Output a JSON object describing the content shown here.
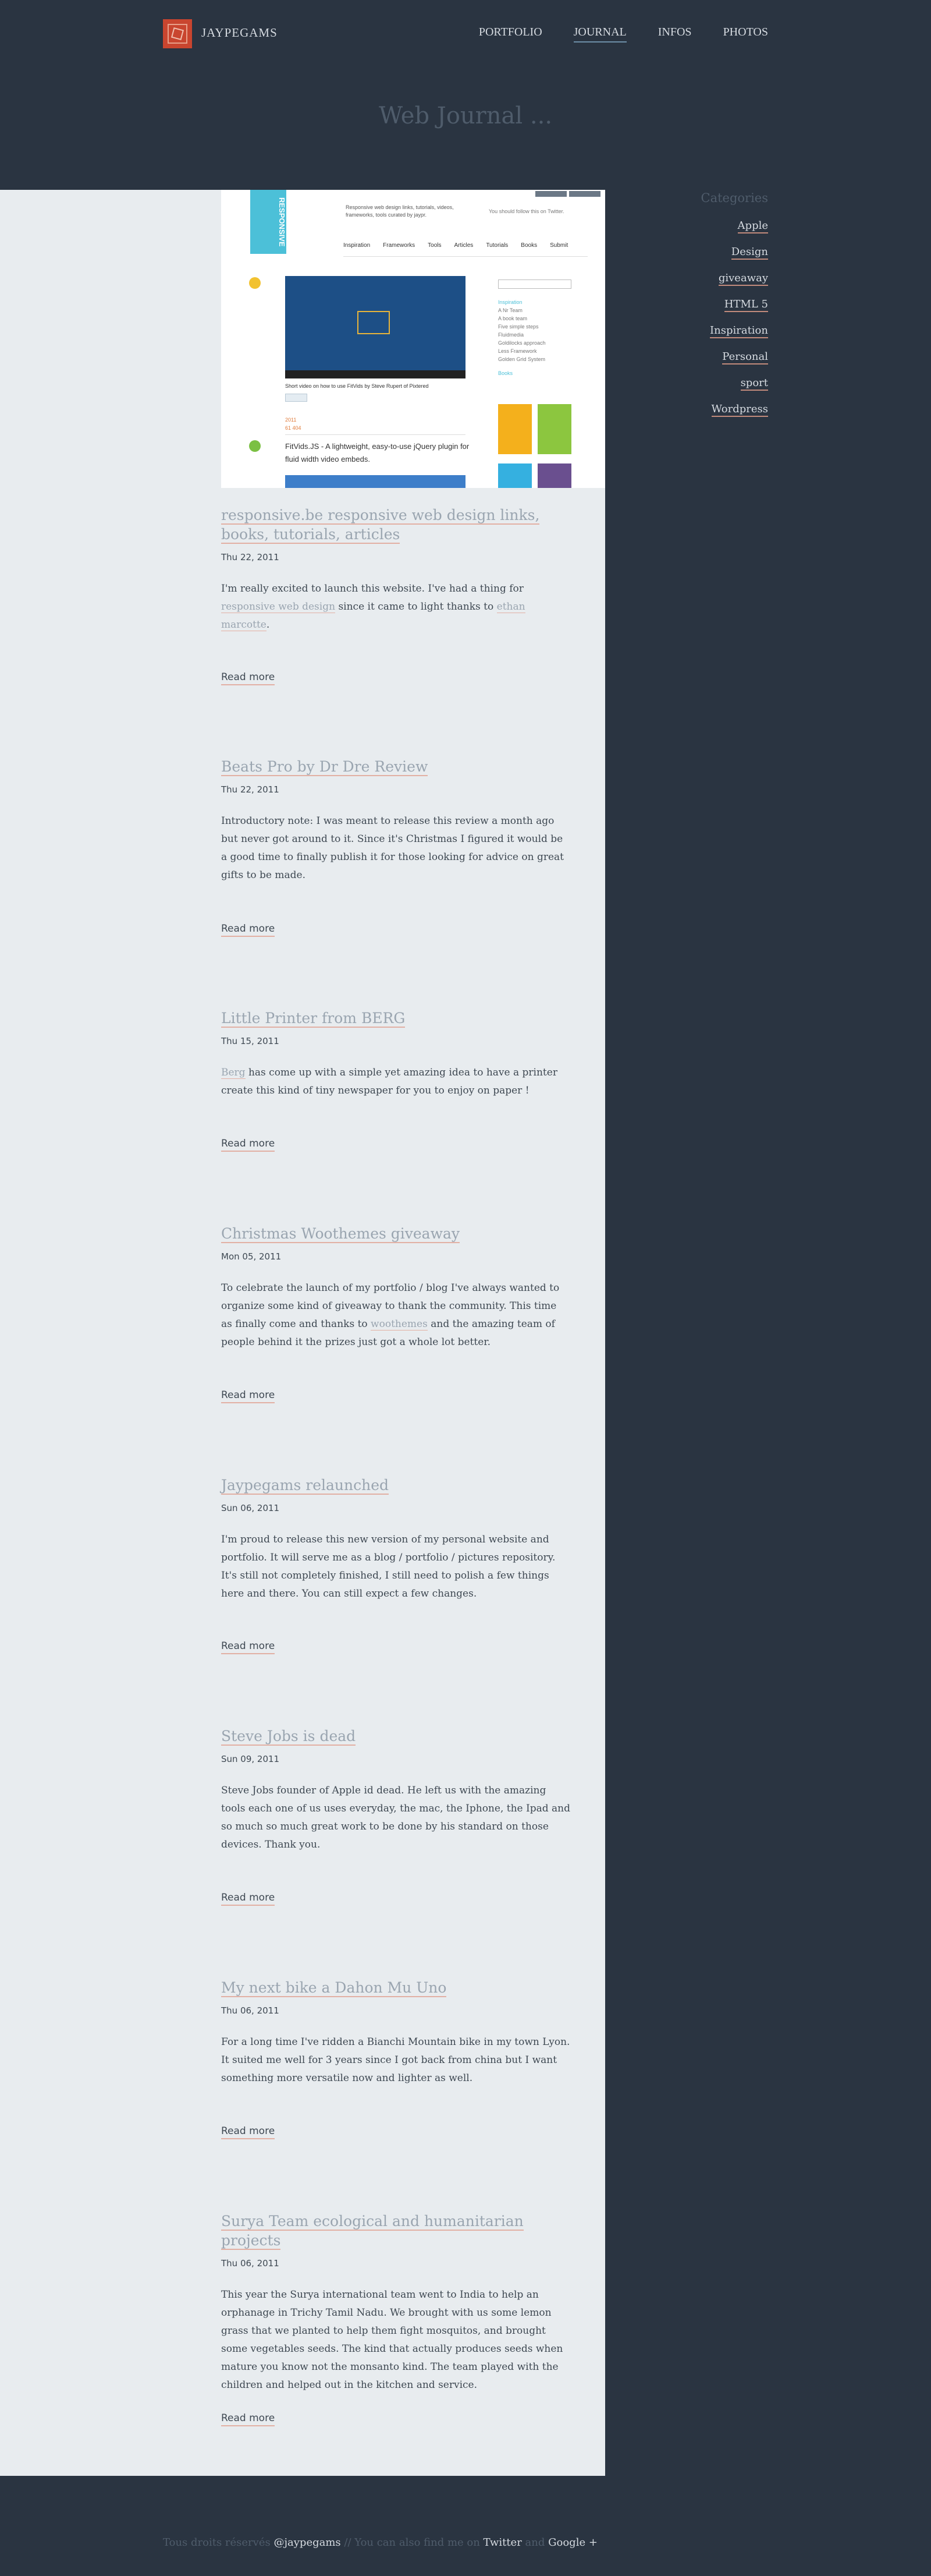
{
  "site": {
    "logo_text": "JAYPEGAMS",
    "nav": [
      {
        "label": "PORTFOLIO",
        "active": false
      },
      {
        "label": "JOURNAL",
        "active": true
      },
      {
        "label": "INFOS",
        "active": false
      },
      {
        "label": "PHOTOS",
        "active": false
      }
    ],
    "page_title": "Web Journal ..."
  },
  "hero": {
    "badge": "RESPONSIVE",
    "tagline": "Responsive web design links, tutorials, videos, frameworks, tools curated by jaypr.",
    "follow": "You should follow this on Twitter.",
    "menu": [
      "Inspiration",
      "Frameworks",
      "Tools",
      "Articles",
      "Tutorials",
      "Books",
      "Submit"
    ],
    "video_caption": "Short video on how to use FitVids by Steve Rupert of Pixtered",
    "tweet_label": "Tweet",
    "meta": [
      "2011",
      "61 404",
      "Video Tools"
    ],
    "fitvids_text": "FitVids.JS - A lightweight, easy-to-use jQuery plugin for fluid width video embeds.",
    "side_list": [
      "Inspiration",
      "A Nr Team",
      "A book team",
      "Five simple steps",
      "Fluidmedia",
      "Goldilocks approach",
      "Less Framework",
      "Golden Grid System",
      "Books"
    ]
  },
  "posts": [
    {
      "title": "responsive.be responsive web design links, books, tutorials, articles",
      "date": "Thu 22, 2011",
      "excerpt": [
        {
          "text": "I'm really excited to launch this website. I've had a thing for ",
          "link": false
        },
        {
          "text": "responsive web design",
          "link": true
        },
        {
          "text": " since it came to light thanks to ",
          "link": false
        },
        {
          "text": "ethan marcotte",
          "link": true
        },
        {
          "text": ".",
          "link": false
        }
      ],
      "read_more": "Read more"
    },
    {
      "title": "Beats Pro by Dr Dre Review",
      "date": "Thu 22, 2011",
      "excerpt": [
        {
          "text": "Introductory note: I was meant to release this review a month ago but never got around to it. Since it's Christmas I figured it would be a good time to finally publish it for those looking for advice on great gifts to be made.",
          "link": false
        }
      ],
      "read_more": "Read more"
    },
    {
      "title": "Little Printer from BERG",
      "date": "Thu 15, 2011",
      "excerpt": [
        {
          "text": "Berg",
          "link": true
        },
        {
          "text": " has come up with a simple yet amazing idea to have a printer create this kind of tiny newspaper for you to enjoy on paper !",
          "link": false
        }
      ],
      "read_more": "Read more"
    },
    {
      "title": "Christmas Woothemes giveaway",
      "date": "Mon 05, 2011",
      "excerpt": [
        {
          "text": "To celebrate the launch of my portfolio / blog I've always wanted to organize some kind of giveaway to thank the community. This time as finally come and thanks to ",
          "link": false
        },
        {
          "text": "woothemes",
          "link": true
        },
        {
          "text": " and the amazing team of people behind it the prizes just got a whole lot better.",
          "link": false
        }
      ],
      "read_more": "Read more"
    },
    {
      "title": "Jaypegams relaunched",
      "date": "Sun 06, 2011",
      "excerpt": [
        {
          "text": "I'm proud to release this new version of my personal website and portfolio. It will serve me as a blog / portfolio / pictures repository. It's still not completely finished, I still need to polish a few things here and there. You can still expect a few changes.",
          "link": false
        }
      ],
      "read_more": "Read more"
    },
    {
      "title": "Steve Jobs is dead",
      "date": "Sun 09, 2011",
      "excerpt": [
        {
          "text": "Steve Jobs founder of Apple id dead. He left us with the amazing tools each one of us uses everyday, the mac, the Iphone, the Ipad and so much so much great work to be done by his standard on those devices. Thank you.",
          "link": false
        }
      ],
      "read_more": "Read more"
    },
    {
      "title": "My next bike a Dahon Mu Uno",
      "date": "Thu 06, 2011",
      "excerpt": [
        {
          "text": "For a long time I've ridden a Bianchi Mountain bike in my town Lyon. It suited me well for 3 years since I got back from china but I want something more versatile now and lighter as well.",
          "link": false
        }
      ],
      "read_more": "Read more"
    },
    {
      "title": "Surya Team ecological and humanitarian projects",
      "date": "Thu 06, 2011",
      "excerpt": [
        {
          "text": "This year the Surya international team went to India to help an orphanage in Trichy Tamil Nadu. We brought with us some lemon grass that we planted to help them fight mosquitos, and brought some vegetables seeds. The kind that actually produces seeds when mature you know not the monsanto kind.  The team played with the children and helped out in the kitchen and service.",
          "link": false
        }
      ],
      "read_more": "Read more"
    }
  ],
  "sidebar": {
    "title": "Categories",
    "categories": [
      "Apple",
      "Design",
      "giveaway",
      "HTML 5",
      "Inspiration",
      "Personal",
      "sport",
      "Wordpress"
    ]
  },
  "footer": {
    "prefix": "Tous droits réservés ",
    "handle": "@jaypegams",
    "middle": " // You can also find me on ",
    "twitter": "Twitter",
    "and": " and ",
    "google": "Google +"
  }
}
